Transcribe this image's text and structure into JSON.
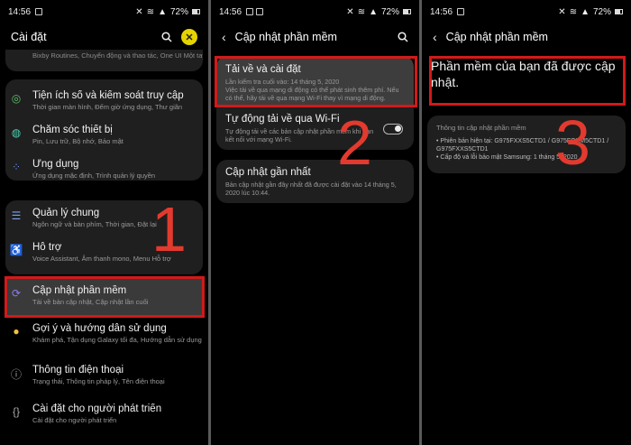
{
  "panel1": {
    "time": "14:56",
    "battery": "72%",
    "title": "Cài đặt",
    "partial_sub": "Bixby Routines, Chuyển động và thao tác, One UI Một tay",
    "items": [
      {
        "title": "Tiện ích số và kiểm soát truy cập",
        "sub": "Thời gian màn hình, Đếm giờ ứng dụng, Thư giãn",
        "icon": "circle-ring-icon"
      },
      {
        "title": "Chăm sóc thiết bị",
        "sub": "Pin, Lưu trữ, Bộ nhớ, Bảo mật",
        "icon": "refresh-ring-icon"
      },
      {
        "title": "Ứng dụng",
        "sub": "Ứng dụng mặc định, Trình quản lý quyền",
        "icon": "apps-grid-icon"
      },
      {
        "title": "Quản lý chung",
        "sub": "Ngôn ngữ và bàn phím, Thời gian, Đặt lại",
        "icon": "sliders-icon"
      },
      {
        "title": "Hỗ trợ",
        "sub": "Voice Assistant, Âm thanh mono, Menu Hỗ trợ",
        "icon": "accessibility-icon"
      },
      {
        "title": "Cập nhật phần mềm",
        "sub": "Tải về bản cập nhật, Cập nhật lần cuối",
        "icon": "update-icon"
      },
      {
        "title": "Gợi ý và hướng dẫn sử dụng",
        "sub": "Khám phá, Tận dụng Galaxy tối đa, Hướng dẫn sử dụng",
        "icon": "bulb-icon"
      },
      {
        "title": "Thông tin điện thoại",
        "sub": "Trạng thái, Thông tin pháp lý, Tên điện thoại",
        "icon": "info-icon"
      },
      {
        "title": "Cài đặt cho người phát triển",
        "sub": "Cài đặt cho người phát triển",
        "icon": "braces-icon"
      }
    ],
    "step": "1"
  },
  "panel2": {
    "time": "14:56",
    "battery": "72%",
    "title": "Cập nhật phần mềm",
    "download_title": "Tải về và cài đặt",
    "download_sub1": "Lần kiểm tra cuối vào: 14 tháng 5, 2020",
    "download_sub2": "Việc tải về qua mạng di động có thể phát sinh thêm phí. Nếu có thể, hãy tải về qua mạng Wi-Fi thay vì mạng di động.",
    "wifi_title": "Tự động tải về qua Wi-Fi",
    "wifi_sub": "Tự động tải về các bản cập nhật phần mềm khi bạn kết nối với mạng Wi-Fi.",
    "last_title": "Cập nhật gần nhất",
    "last_sub": "Bản cập nhật gần đây nhất đã được cài đặt vào 14 tháng 5, 2020 lúc 10:44.",
    "step": "2"
  },
  "panel3": {
    "time": "14:56",
    "battery": "72%",
    "title": "Cập nhật phần mềm",
    "message": "Phần mềm của bạn đã được cập nhật.",
    "info_header": "Thông tin cập nhật phần mềm",
    "info_line1": "• Phiên bản hiện tại: G975FXXS5CTD1 / G975FOXM5CTD1 / G975FXXS5CTD1",
    "info_line2": "• Cấp độ vá lỗi bảo mật Samsung: 1 tháng 5, 2020",
    "step": "3"
  },
  "colors": {
    "highlight": "#d11a1a",
    "step_number": "#e23a2e"
  }
}
